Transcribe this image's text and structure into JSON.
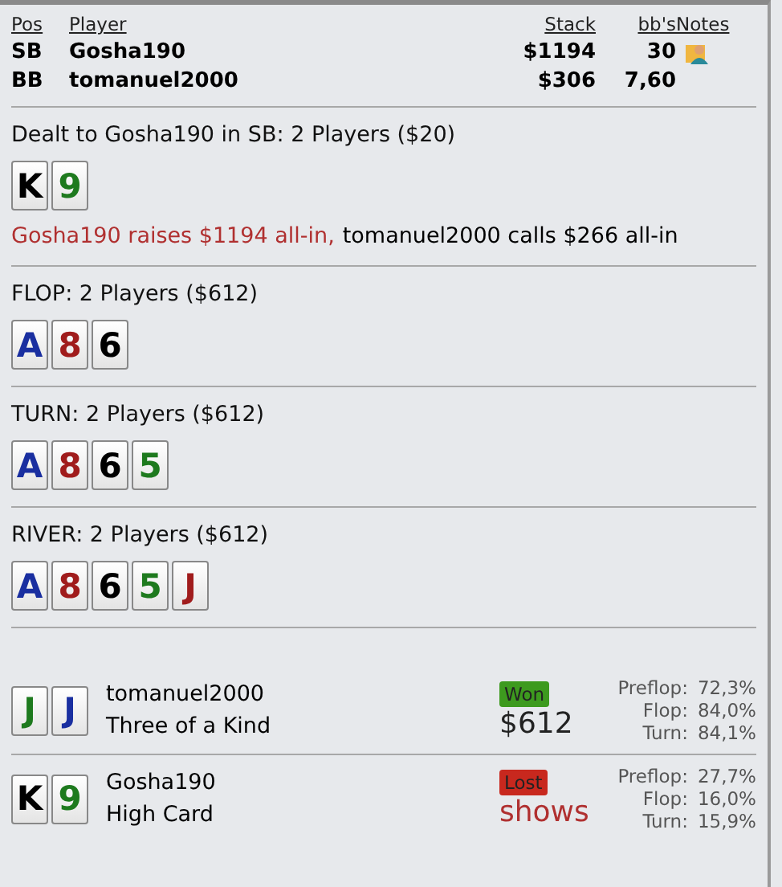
{
  "players_table": {
    "columns": [
      "Pos",
      "Player",
      "Stack",
      "bb's",
      "Notes"
    ],
    "rows": [
      {
        "pos": "SB",
        "player": "Gosha190",
        "stack": "$1194",
        "bbs": "30",
        "has_note": true
      },
      {
        "pos": "BB",
        "player": "tomanuel2000",
        "stack": "$306",
        "bbs": "7,60",
        "has_note": false
      }
    ]
  },
  "streets": [
    {
      "title": "Dealt to Gosha190 in SB: 2 Players ($20)",
      "cards": [
        {
          "rank": "K",
          "color": "#000000"
        },
        {
          "rank": "9",
          "color": "#1e7a1e"
        }
      ],
      "actions": [
        {
          "text": "Gosha190 raises $1194 all-in,",
          "color": "#b03030"
        },
        {
          "text": "tomanuel2000 calls $266 all-in",
          "color": "#000000"
        }
      ]
    },
    {
      "title": "FLOP: 2 Players ($612)",
      "cards": [
        {
          "rank": "A",
          "color": "#1a2fa0"
        },
        {
          "rank": "8",
          "color": "#a01c1c"
        },
        {
          "rank": "6",
          "color": "#000000"
        }
      ]
    },
    {
      "title": "TURN: 2 Players ($612)",
      "cards": [
        {
          "rank": "A",
          "color": "#1a2fa0"
        },
        {
          "rank": "8",
          "color": "#a01c1c"
        },
        {
          "rank": "6",
          "color": "#000000"
        },
        {
          "rank": "5",
          "color": "#1e7a1e"
        }
      ]
    },
    {
      "title": "RIVER: 2 Players ($612)",
      "cards": [
        {
          "rank": "A",
          "color": "#1a2fa0"
        },
        {
          "rank": "8",
          "color": "#a01c1c"
        },
        {
          "rank": "6",
          "color": "#000000"
        },
        {
          "rank": "5",
          "color": "#1e7a1e"
        },
        {
          "rank": "J",
          "color": "#a01c1c"
        }
      ]
    }
  ],
  "showdown": [
    {
      "player": "tomanuel2000",
      "hand": "Three of a Kind",
      "cards": [
        {
          "rank": "J",
          "color": "#1e7a1e"
        },
        {
          "rank": "J",
          "color": "#1a2fa0"
        }
      ],
      "result": {
        "kind": "won",
        "badge": "Won",
        "amount": "$612"
      },
      "equity": [
        {
          "label": "Preflop:",
          "value": "72,3%"
        },
        {
          "label": "Flop:",
          "value": "84,0%"
        },
        {
          "label": "Turn:",
          "value": "84,1%"
        }
      ]
    },
    {
      "player": "Gosha190",
      "hand": "High Card",
      "cards": [
        {
          "rank": "K",
          "color": "#000000"
        },
        {
          "rank": "9",
          "color": "#1e7a1e"
        }
      ],
      "result": {
        "kind": "lost",
        "badge": "Lost",
        "amount": "shows"
      },
      "equity": [
        {
          "label": "Preflop:",
          "value": "27,7%"
        },
        {
          "label": "Flop:",
          "value": "16,0%"
        },
        {
          "label": "Turn:",
          "value": "15,9%"
        }
      ]
    }
  ]
}
